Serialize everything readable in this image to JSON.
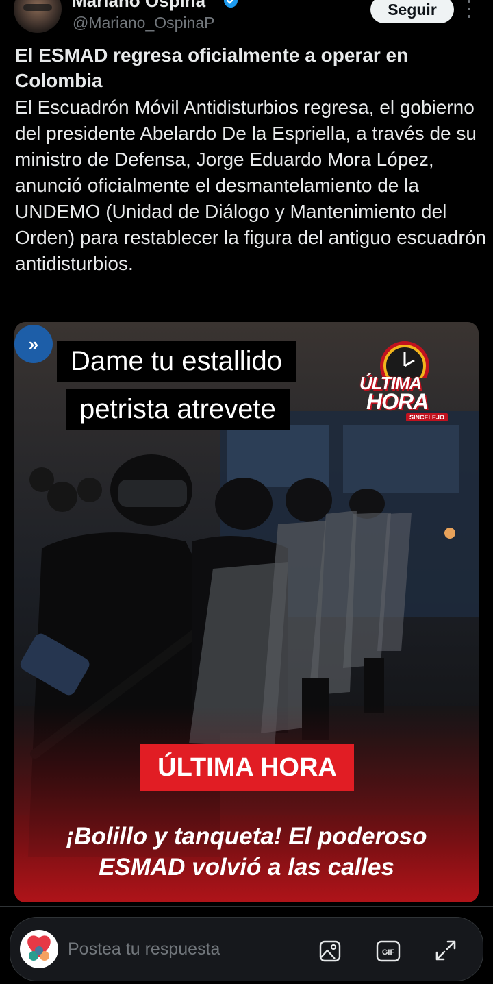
{
  "author": {
    "display_name": "Mariano Ospina",
    "handle": "@Mariano_OspinaP",
    "follow_label": "Seguir"
  },
  "post": {
    "title": "El ESMAD regresa oficialmente a operar en Colombia",
    "body": "El Escuadrón Móvil Antidisturbios regresa, el gobierno del presidente Abelardo De la Espriella, a través de su ministro de Defensa, Jorge Eduardo Mora López, anunció oficialmente el desmantelamiento de la UNDEMO (Unidad de Diálogo y Mantenimiento del Orden) para restablecer la figura del antiguo escuadrón antidisturbios."
  },
  "media": {
    "expand_badge": "»",
    "overlay_line1": "Dame tu estallido",
    "overlay_line2": "petrista atrevete",
    "logo_line1": "ÚLTIMA",
    "logo_line2": "HORA",
    "logo_city": "SINCELEJO",
    "badge": "ÚLTIMA HORA",
    "headline_line1": "¡Bolillo y tanqueta! El poderoso",
    "headline_line2": "ESMAD volvió a las calles"
  },
  "reply": {
    "placeholder": "Postea tu respuesta"
  },
  "colors": {
    "accent_red": "#e11d24",
    "verified_blue": "#1d9bf0",
    "background": "#000000"
  }
}
